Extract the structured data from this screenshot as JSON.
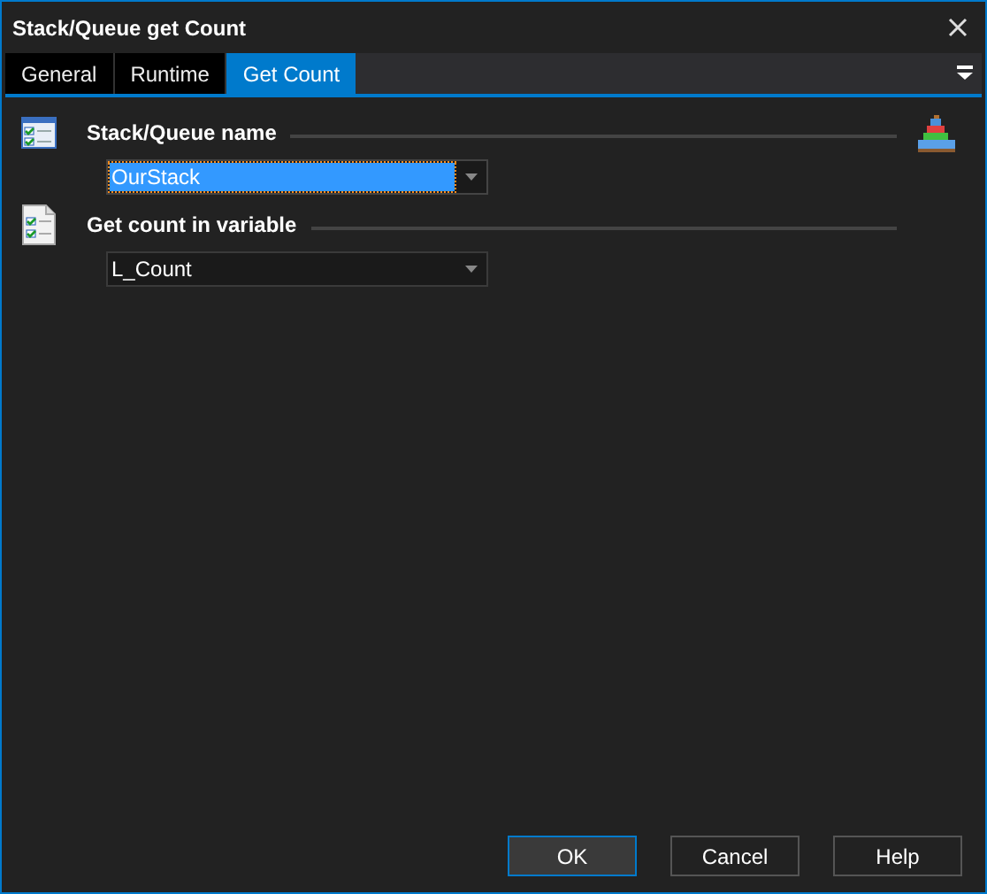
{
  "window": {
    "title": "Stack/Queue get Count"
  },
  "tabs": [
    {
      "label": "General",
      "selected": false
    },
    {
      "label": "Runtime",
      "selected": false
    },
    {
      "label": "Get Count",
      "selected": true
    }
  ],
  "sections": [
    {
      "label": "Stack/Queue name",
      "value": "OurStack",
      "focused": true
    },
    {
      "label": "Get count in variable",
      "value": "L_Count",
      "focused": false
    }
  ],
  "buttons": [
    {
      "label": "OK",
      "default": true
    },
    {
      "label": "Cancel",
      "default": false
    },
    {
      "label": "Help",
      "default": false
    }
  ]
}
